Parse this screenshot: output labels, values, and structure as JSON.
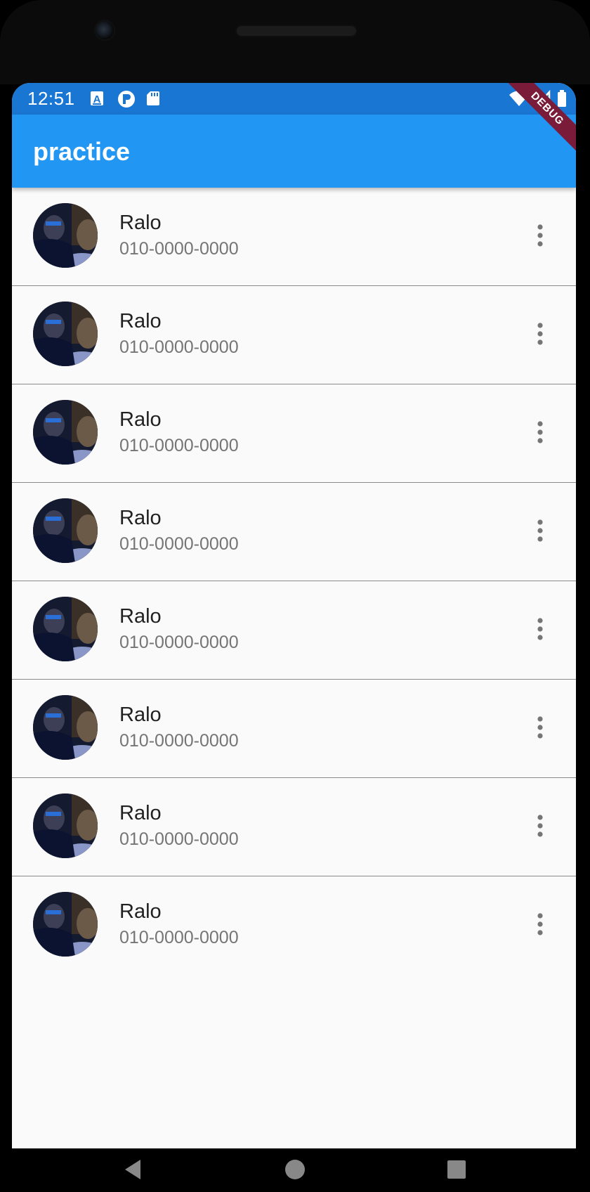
{
  "status_bar": {
    "time": "12:51",
    "left_icons": [
      "a-badge-icon",
      "p-circle-icon",
      "sd-card-icon"
    ],
    "right_icons": [
      "wifi-icon",
      "cell-signal-icon",
      "battery-icon"
    ]
  },
  "app_bar": {
    "title": "practice"
  },
  "debug_banner": {
    "label": "DEBUG"
  },
  "contacts": [
    {
      "name": "Ralo",
      "phone": "010-0000-0000"
    },
    {
      "name": "Ralo",
      "phone": "010-0000-0000"
    },
    {
      "name": "Ralo",
      "phone": "010-0000-0000"
    },
    {
      "name": "Ralo",
      "phone": "010-0000-0000"
    },
    {
      "name": "Ralo",
      "phone": "010-0000-0000"
    },
    {
      "name": "Ralo",
      "phone": "010-0000-0000"
    },
    {
      "name": "Ralo",
      "phone": "010-0000-0000"
    },
    {
      "name": "Ralo",
      "phone": "010-0000-0000"
    }
  ],
  "nav_bar": {
    "icons": [
      "back-icon",
      "home-icon",
      "recents-icon"
    ]
  },
  "colors": {
    "status_bar": "#1976d2",
    "app_bar": "#2196f3",
    "debug_banner": "#7a1b3a",
    "list_background": "#fafafa"
  }
}
